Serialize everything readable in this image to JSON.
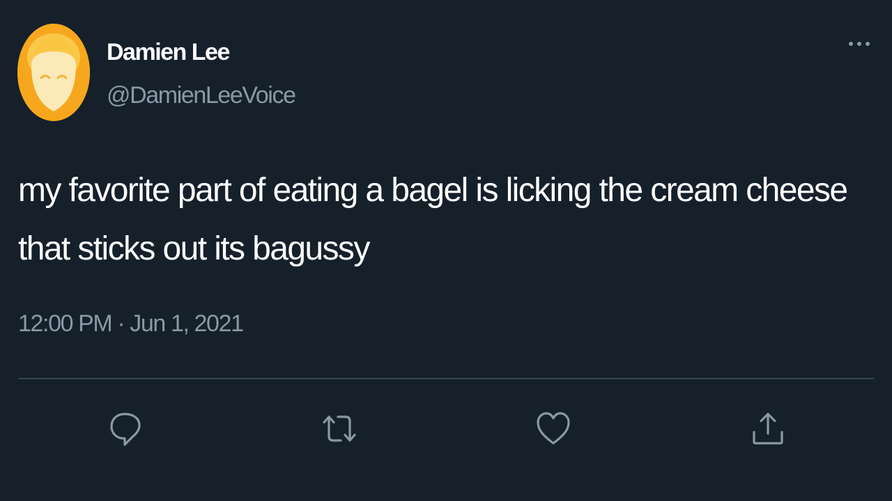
{
  "tweet": {
    "author": {
      "display_name": "Damien Lee",
      "handle": "@DamienLeeVoice",
      "avatar_icon": "avatar-illustration"
    },
    "text": "my favorite part of eating a bagel is licking the cream cheese that sticks out its bagussy",
    "time": "12:00 PM",
    "separator": "·",
    "date": "Jun 1, 2021",
    "more_icon": "more-horizontal-icon"
  },
  "actions": [
    {
      "name": "reply",
      "icon": "reply-icon"
    },
    {
      "name": "retweet",
      "icon": "retweet-icon"
    },
    {
      "name": "like",
      "icon": "heart-icon"
    },
    {
      "name": "share",
      "icon": "share-icon"
    }
  ],
  "colors": {
    "background": "#15202b",
    "primary_text": "#ffffff",
    "secondary_text": "#8b98a5",
    "divider": "#38444d",
    "icon": "#8b98a5",
    "avatar_bg": "#f6a71d"
  }
}
